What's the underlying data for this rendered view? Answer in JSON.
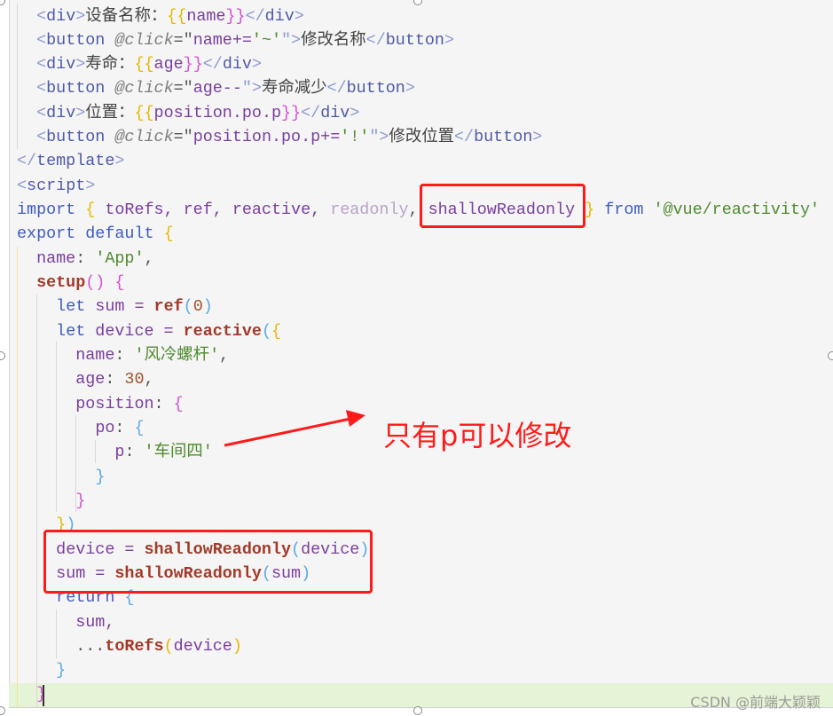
{
  "code_lines": [
    {
      "indent": 1,
      "tokens": [
        [
          "<",
          "ang"
        ],
        [
          "div",
          "tag"
        ],
        [
          ">",
          "ang"
        ],
        [
          "设备名称：",
          "txt"
        ],
        [
          "{{",
          "b1"
        ],
        [
          "name",
          "var"
        ],
        [
          "}}",
          "b2"
        ],
        [
          "</",
          "ang"
        ],
        [
          "div",
          "tag"
        ],
        [
          ">",
          "ang"
        ]
      ]
    },
    {
      "indent": 1,
      "tokens": [
        [
          "<",
          "ang"
        ],
        [
          "button",
          "tag"
        ],
        [
          " ",
          "p"
        ],
        [
          "@click",
          "attr"
        ],
        [
          "=\"",
          "p"
        ],
        [
          "name+=",
          "var"
        ],
        [
          "'~'",
          "str"
        ],
        [
          "\">",
          "ang"
        ],
        [
          "修改名称",
          "txt"
        ],
        [
          "</",
          "ang"
        ],
        [
          "button",
          "tag"
        ],
        [
          ">",
          "ang"
        ]
      ]
    },
    {
      "indent": 1,
      "tokens": [
        [
          "<",
          "ang"
        ],
        [
          "div",
          "tag"
        ],
        [
          ">",
          "ang"
        ],
        [
          "寿命：",
          "txt"
        ],
        [
          "{{",
          "b1"
        ],
        [
          "age",
          "var"
        ],
        [
          "}}",
          "b2"
        ],
        [
          "</",
          "ang"
        ],
        [
          "div",
          "tag"
        ],
        [
          ">",
          "ang"
        ]
      ]
    },
    {
      "indent": 1,
      "tokens": [
        [
          "<",
          "ang"
        ],
        [
          "button",
          "tag"
        ],
        [
          " ",
          "p"
        ],
        [
          "@click",
          "attr"
        ],
        [
          "=\"",
          "p"
        ],
        [
          "age--",
          "var"
        ],
        [
          "\">",
          "ang"
        ],
        [
          "寿命减少",
          "txt"
        ],
        [
          "</",
          "ang"
        ],
        [
          "button",
          "tag"
        ],
        [
          ">",
          "ang"
        ]
      ]
    },
    {
      "indent": 1,
      "tokens": [
        [
          "<",
          "ang"
        ],
        [
          "div",
          "tag"
        ],
        [
          ">",
          "ang"
        ],
        [
          "位置：",
          "txt"
        ],
        [
          "{{",
          "b1"
        ],
        [
          "position.po.p",
          "var"
        ],
        [
          "}}",
          "b2"
        ],
        [
          "</",
          "ang"
        ],
        [
          "div",
          "tag"
        ],
        [
          ">",
          "ang"
        ]
      ]
    },
    {
      "indent": 1,
      "tokens": [
        [
          "<",
          "ang"
        ],
        [
          "button",
          "tag"
        ],
        [
          " ",
          "p"
        ],
        [
          "@click",
          "attr"
        ],
        [
          "=\"",
          "p"
        ],
        [
          "position.po.p+=",
          "var"
        ],
        [
          "'!'",
          "str"
        ],
        [
          "\">",
          "ang"
        ],
        [
          "修改位置",
          "txt"
        ],
        [
          "</",
          "ang"
        ],
        [
          "button",
          "tag"
        ],
        [
          ">",
          "ang"
        ]
      ]
    },
    {
      "indent": 0,
      "tokens": [
        [
          "</",
          "ang"
        ],
        [
          "template",
          "tag"
        ],
        [
          ">",
          "ang"
        ]
      ]
    },
    {
      "indent": 0,
      "tokens": [
        [
          "<",
          "ang"
        ],
        [
          "script",
          "tag"
        ],
        [
          ">",
          "ang"
        ]
      ]
    },
    {
      "indent": 0,
      "tokens": [
        [
          "import",
          "kw"
        ],
        [
          " ",
          "p"
        ],
        [
          "{",
          "b1"
        ],
        [
          " toRefs, ref, reactive, ",
          "var"
        ],
        [
          "readonly",
          "dim"
        ],
        [
          ", ",
          "p"
        ],
        [
          "shallowReadonly",
          "var"
        ],
        [
          " ",
          "p"
        ],
        [
          "}",
          "b1"
        ],
        [
          " ",
          "p"
        ],
        [
          "from",
          "kw"
        ],
        [
          " ",
          "p"
        ],
        [
          "'@vue/reactivity'",
          "str"
        ]
      ]
    },
    {
      "indent": 0,
      "tokens": [
        [
          "export default",
          "kw"
        ],
        [
          " ",
          "p"
        ],
        [
          "{",
          "b1"
        ]
      ]
    },
    {
      "indent": 1,
      "tokens": [
        [
          "name",
          "prop"
        ],
        [
          ": ",
          "p"
        ],
        [
          "'App'",
          "str"
        ],
        [
          ",",
          "p"
        ]
      ]
    },
    {
      "indent": 1,
      "tokens": [
        [
          "setup",
          "fn"
        ],
        [
          "()",
          "b2"
        ],
        [
          " ",
          "p"
        ],
        [
          "{",
          "b2"
        ]
      ]
    },
    {
      "indent": 2,
      "tokens": [
        [
          "let",
          "kw"
        ],
        [
          " sum = ",
          "var"
        ],
        [
          "ref",
          "fn"
        ],
        [
          "(",
          "b3"
        ],
        [
          "0",
          "num"
        ],
        [
          ")",
          "b3"
        ]
      ]
    },
    {
      "indent": 2,
      "tokens": [
        [
          "let",
          "kw"
        ],
        [
          " device = ",
          "var"
        ],
        [
          "reactive",
          "fn"
        ],
        [
          "(",
          "b3"
        ],
        [
          "{",
          "b1"
        ]
      ]
    },
    {
      "indent": 3,
      "tokens": [
        [
          "name",
          "prop"
        ],
        [
          ": ",
          "p"
        ],
        [
          "'风冷螺杆'",
          "str"
        ],
        [
          ",",
          "p"
        ]
      ]
    },
    {
      "indent": 3,
      "tokens": [
        [
          "age",
          "prop"
        ],
        [
          ": ",
          "p"
        ],
        [
          "30",
          "num"
        ],
        [
          ",",
          "p"
        ]
      ]
    },
    {
      "indent": 3,
      "tokens": [
        [
          "position",
          "prop"
        ],
        [
          ": ",
          "p"
        ],
        [
          "{",
          "b2"
        ]
      ]
    },
    {
      "indent": 4,
      "tokens": [
        [
          "po",
          "prop"
        ],
        [
          ": ",
          "p"
        ],
        [
          "{",
          "b3"
        ]
      ]
    },
    {
      "indent": 5,
      "tokens": [
        [
          "p",
          "prop"
        ],
        [
          ": ",
          "p"
        ],
        [
          "'车间四'",
          "str"
        ]
      ]
    },
    {
      "indent": 4,
      "tokens": [
        [
          "}",
          "b3"
        ]
      ]
    },
    {
      "indent": 3,
      "tokens": [
        [
          "}",
          "b2"
        ]
      ]
    },
    {
      "indent": 2,
      "tokens": [
        [
          "}",
          "b1"
        ],
        [
          ")",
          "b3"
        ]
      ]
    },
    {
      "indent": 2,
      "tokens": [
        [
          "device = ",
          "var"
        ],
        [
          "shallowReadonly",
          "fn"
        ],
        [
          "(",
          "b3"
        ],
        [
          "device",
          "var"
        ],
        [
          ")",
          "b3"
        ]
      ]
    },
    {
      "indent": 2,
      "tokens": [
        [
          "sum = ",
          "var"
        ],
        [
          "shallowReadonly",
          "fn"
        ],
        [
          "(",
          "b3"
        ],
        [
          "sum",
          "var"
        ],
        [
          ")",
          "b3"
        ]
      ]
    },
    {
      "indent": 2,
      "tokens": [
        [
          "return",
          "kw"
        ],
        [
          " ",
          "p"
        ],
        [
          "{",
          "b3"
        ]
      ]
    },
    {
      "indent": 3,
      "tokens": [
        [
          "sum,",
          "var"
        ]
      ]
    },
    {
      "indent": 3,
      "tokens": [
        [
          "...",
          "p"
        ],
        [
          "toRefs",
          "fn"
        ],
        [
          "(",
          "b1"
        ],
        [
          "device",
          "var"
        ],
        [
          ")",
          "b1"
        ]
      ]
    },
    {
      "indent": 2,
      "tokens": [
        [
          "}",
          "b3"
        ]
      ]
    },
    {
      "indent": 1,
      "tokens": [
        [
          "}",
          "b2"
        ]
      ]
    }
  ],
  "annotation": {
    "note_text": "只有p可以修改",
    "color": "#ff1a1a"
  },
  "watermark": "CSDN @前端大颖颖"
}
